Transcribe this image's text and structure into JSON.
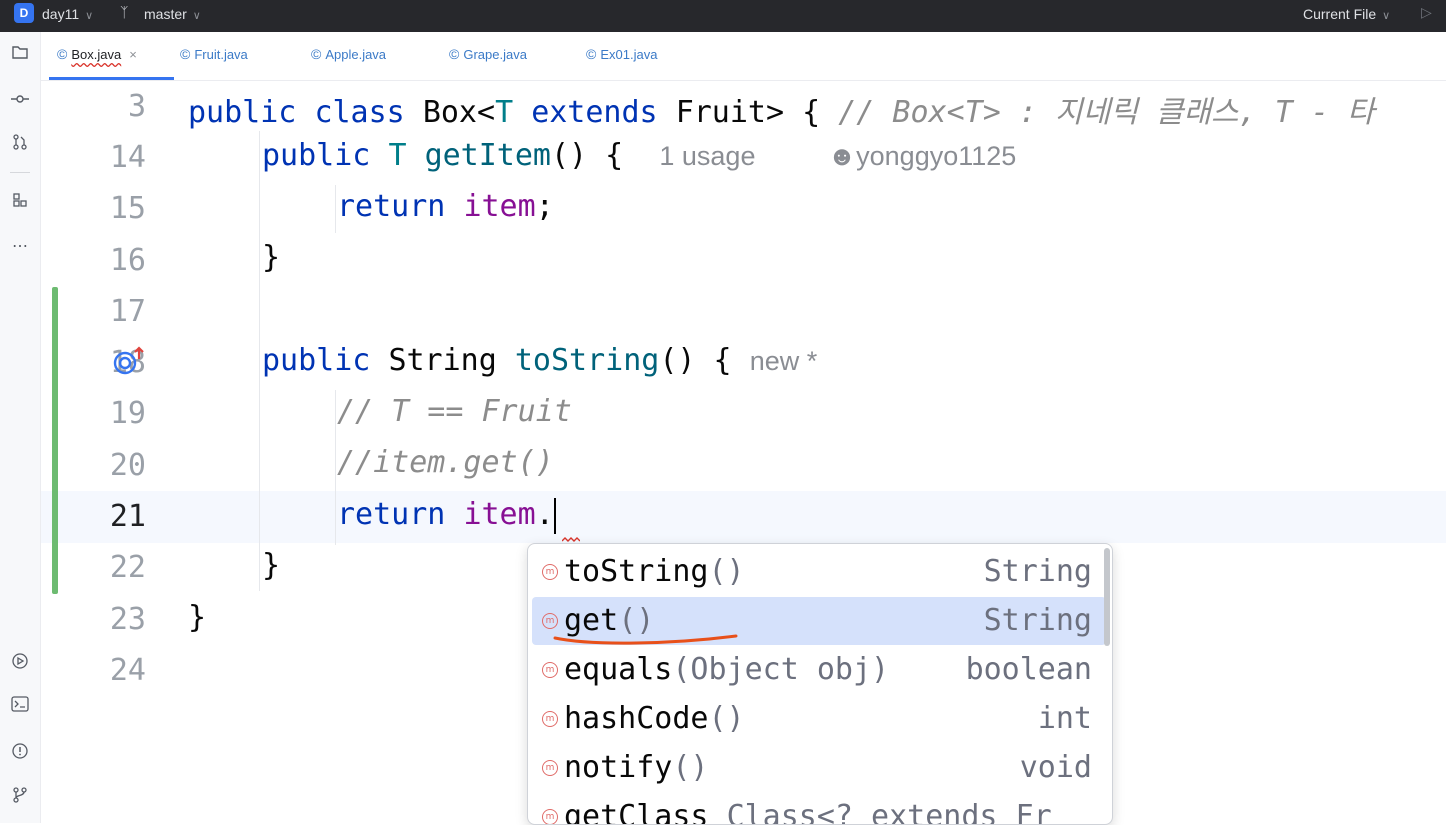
{
  "titlebar": {
    "project_badge": "D",
    "project_name": "day11",
    "branch": "master",
    "run_config": "Current File"
  },
  "tabs": [
    {
      "label": "Box.java",
      "active": true
    },
    {
      "label": "Fruit.java",
      "active": false
    },
    {
      "label": "Apple.java",
      "active": false
    },
    {
      "label": "Grape.java",
      "active": false
    },
    {
      "label": "Ex01.java",
      "active": false
    }
  ],
  "editor": {
    "lines": [
      {
        "num": "3"
      },
      {
        "num": "14"
      },
      {
        "num": "15"
      },
      {
        "num": "16"
      },
      {
        "num": "17"
      },
      {
        "num": "18"
      },
      {
        "num": "19"
      },
      {
        "num": "20"
      },
      {
        "num": "21"
      },
      {
        "num": "22"
      },
      {
        "num": "23"
      },
      {
        "num": "24"
      }
    ],
    "code": {
      "l3_kw1": "public",
      "l3_kw2": "class",
      "l3_name": "Box<",
      "l3_T": "T",
      "l3_extends": "extends",
      "l3_rest": "Fruit> {",
      "l3_comment": "// Box<T> : 지네릭 클래스, T - 타",
      "l14_kw": "public",
      "l14_T": "T",
      "l14_method": "getItem",
      "l14_rest": "() {",
      "l14_usage": "1 usage",
      "l14_author": "yonggyo1125",
      "l15_kw": "return",
      "l15_field": "item",
      "l15_semi": ";",
      "l16": "}",
      "l18_kw": "public",
      "l18_type": "String",
      "l18_method": "toString",
      "l18_rest": "() {",
      "l18_hint": "new *",
      "l19": "// T == Fruit",
      "l20": "//item.get()",
      "l21_kw": "return",
      "l21_field": "item",
      "l21_dot": ".",
      "l22": "}",
      "l23": "}"
    }
  },
  "completion": {
    "items": [
      {
        "name": "toString",
        "params": "()",
        "type": "String",
        "selected": false
      },
      {
        "name": "get",
        "params": "()",
        "type": "String",
        "selected": true
      },
      {
        "name": "equals",
        "params": "(Object obj)",
        "type": "boolean",
        "selected": false
      },
      {
        "name": "hashCode",
        "params": "()",
        "type": "int",
        "selected": false
      },
      {
        "name": "notify",
        "params": "()",
        "type": "void",
        "selected": false
      },
      {
        "name": "getClass",
        "params": "Class<? extends Fr",
        "type": "",
        "selected": false
      }
    ]
  },
  "colors": {
    "keyword": "#0033b3",
    "type_param": "#007e8a",
    "field": "#871094",
    "method": "#00627a",
    "comment": "#8c8c8c",
    "selection": "#d5e1fb",
    "change_marker": "#6dbb71",
    "annotation": "#e8501a"
  },
  "icons": {
    "project_badge": "project-badge",
    "branch": "git-branch-icon",
    "run": "run-icon",
    "left_toolbar": [
      "folder-icon",
      "commit-icon",
      "pull-request-icon",
      "structure-icon",
      "more-icon",
      "run-services-icon",
      "terminal-icon",
      "problems-icon",
      "git-icon"
    ],
    "completion_method": "method-icon",
    "gutter_override": "override-method-icon"
  }
}
